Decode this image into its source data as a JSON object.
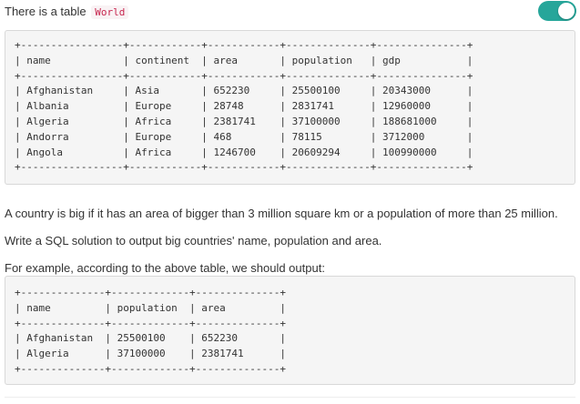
{
  "intro": {
    "text": "There is a table ",
    "table_name": "World"
  },
  "toggle": {
    "state": "on",
    "color": "#26a69a"
  },
  "input_table": {
    "text": "+-----------------+------------+------------+--------------+---------------+\n| name            | continent  | area       | population   | gdp           |\n+-----------------+------------+------------+--------------+---------------+\n| Afghanistan     | Asia       | 652230     | 25500100     | 20343000      |\n| Albania         | Europe     | 28748      | 2831741      | 12960000      |\n| Algeria         | Africa     | 2381741    | 37100000     | 188681000     |\n| Andorra         | Europe     | 468        | 78115        | 3712000       |\n| Angola          | Africa     | 1246700    | 20609294     | 100990000     |\n+-----------------+------------+------------+--------------+---------------+"
  },
  "paragraphs": {
    "p1": "A country is big if it has an area of bigger than 3 million square km or a population of more than 25 million.",
    "p2": "Write a SQL solution to output big countries' name, population and area.",
    "p3": "For example, according to the above table, we should output:"
  },
  "output_table": {
    "text": "+--------------+-------------+--------------+\n| name         | population  | area         |\n+--------------+-------------+--------------+\n| Afghanistan  | 25500100    | 652230       |\n| Algeria      | 37100000    | 2381741      |\n+--------------+-------------+--------------+"
  }
}
